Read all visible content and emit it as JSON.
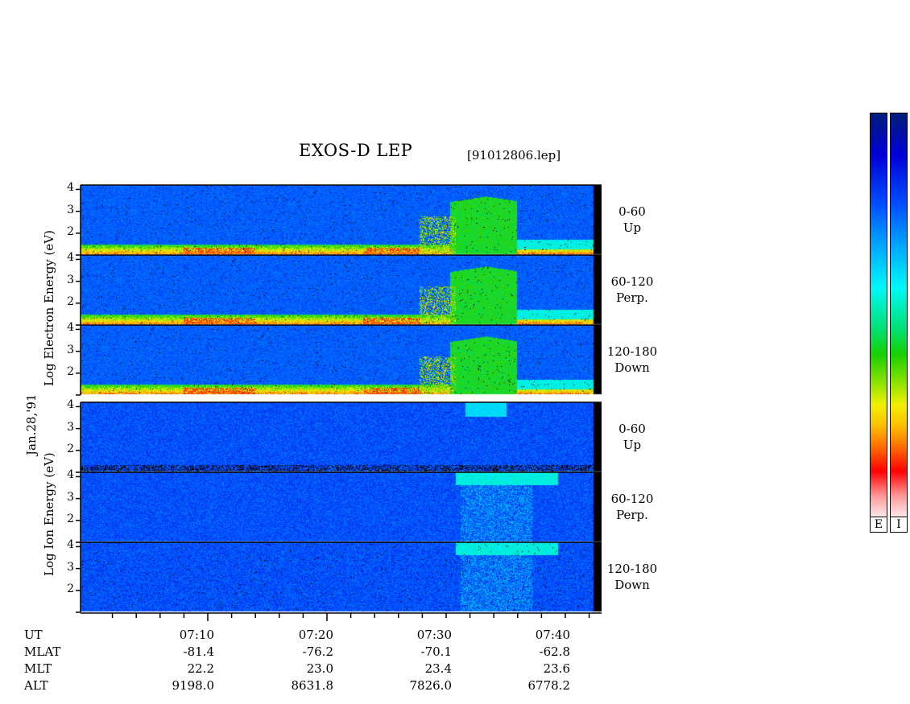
{
  "header": {
    "title": "EXOS-D LEP",
    "filename": "[91012806.lep]"
  },
  "side_labels": {
    "electron": "Log  Electron  Energy (eV)",
    "date": "Jan.28,'91",
    "ion": "Log   Ion   Energy (eV)"
  },
  "colorbar": {
    "e_label": "E",
    "i_label": "I"
  },
  "chart_data": {
    "type": "heatmap",
    "x_ticks": [
      "07:10",
      "07:20",
      "07:30",
      "07:40"
    ],
    "y_ticks": [
      "1",
      "2",
      "3",
      "4"
    ],
    "ylim": [
      1,
      4.2
    ],
    "panels": [
      {
        "species": "Electron",
        "angle": "0-60",
        "direction": "Up"
      },
      {
        "species": "Electron",
        "angle": "60-120",
        "direction": "Perp."
      },
      {
        "species": "Electron",
        "angle": "120-180",
        "direction": "Down"
      },
      {
        "species": "Ion",
        "angle": "0-60",
        "direction": "Up"
      },
      {
        "species": "Ion",
        "angle": "60-120",
        "direction": "Perp."
      },
      {
        "species": "Ion",
        "angle": "120-180",
        "direction": "Down"
      }
    ],
    "ephemeris": {
      "labels": [
        "UT",
        "MLAT",
        "MLT",
        "ALT"
      ],
      "MLAT": [
        "-81.4",
        "-76.2",
        "-70.1",
        "-62.8"
      ],
      "MLT": [
        "22.2",
        "23.0",
        "23.4",
        "23.6"
      ],
      "ALT": [
        "9198.0",
        "8631.8",
        "7826.0",
        "6778.2"
      ]
    }
  }
}
